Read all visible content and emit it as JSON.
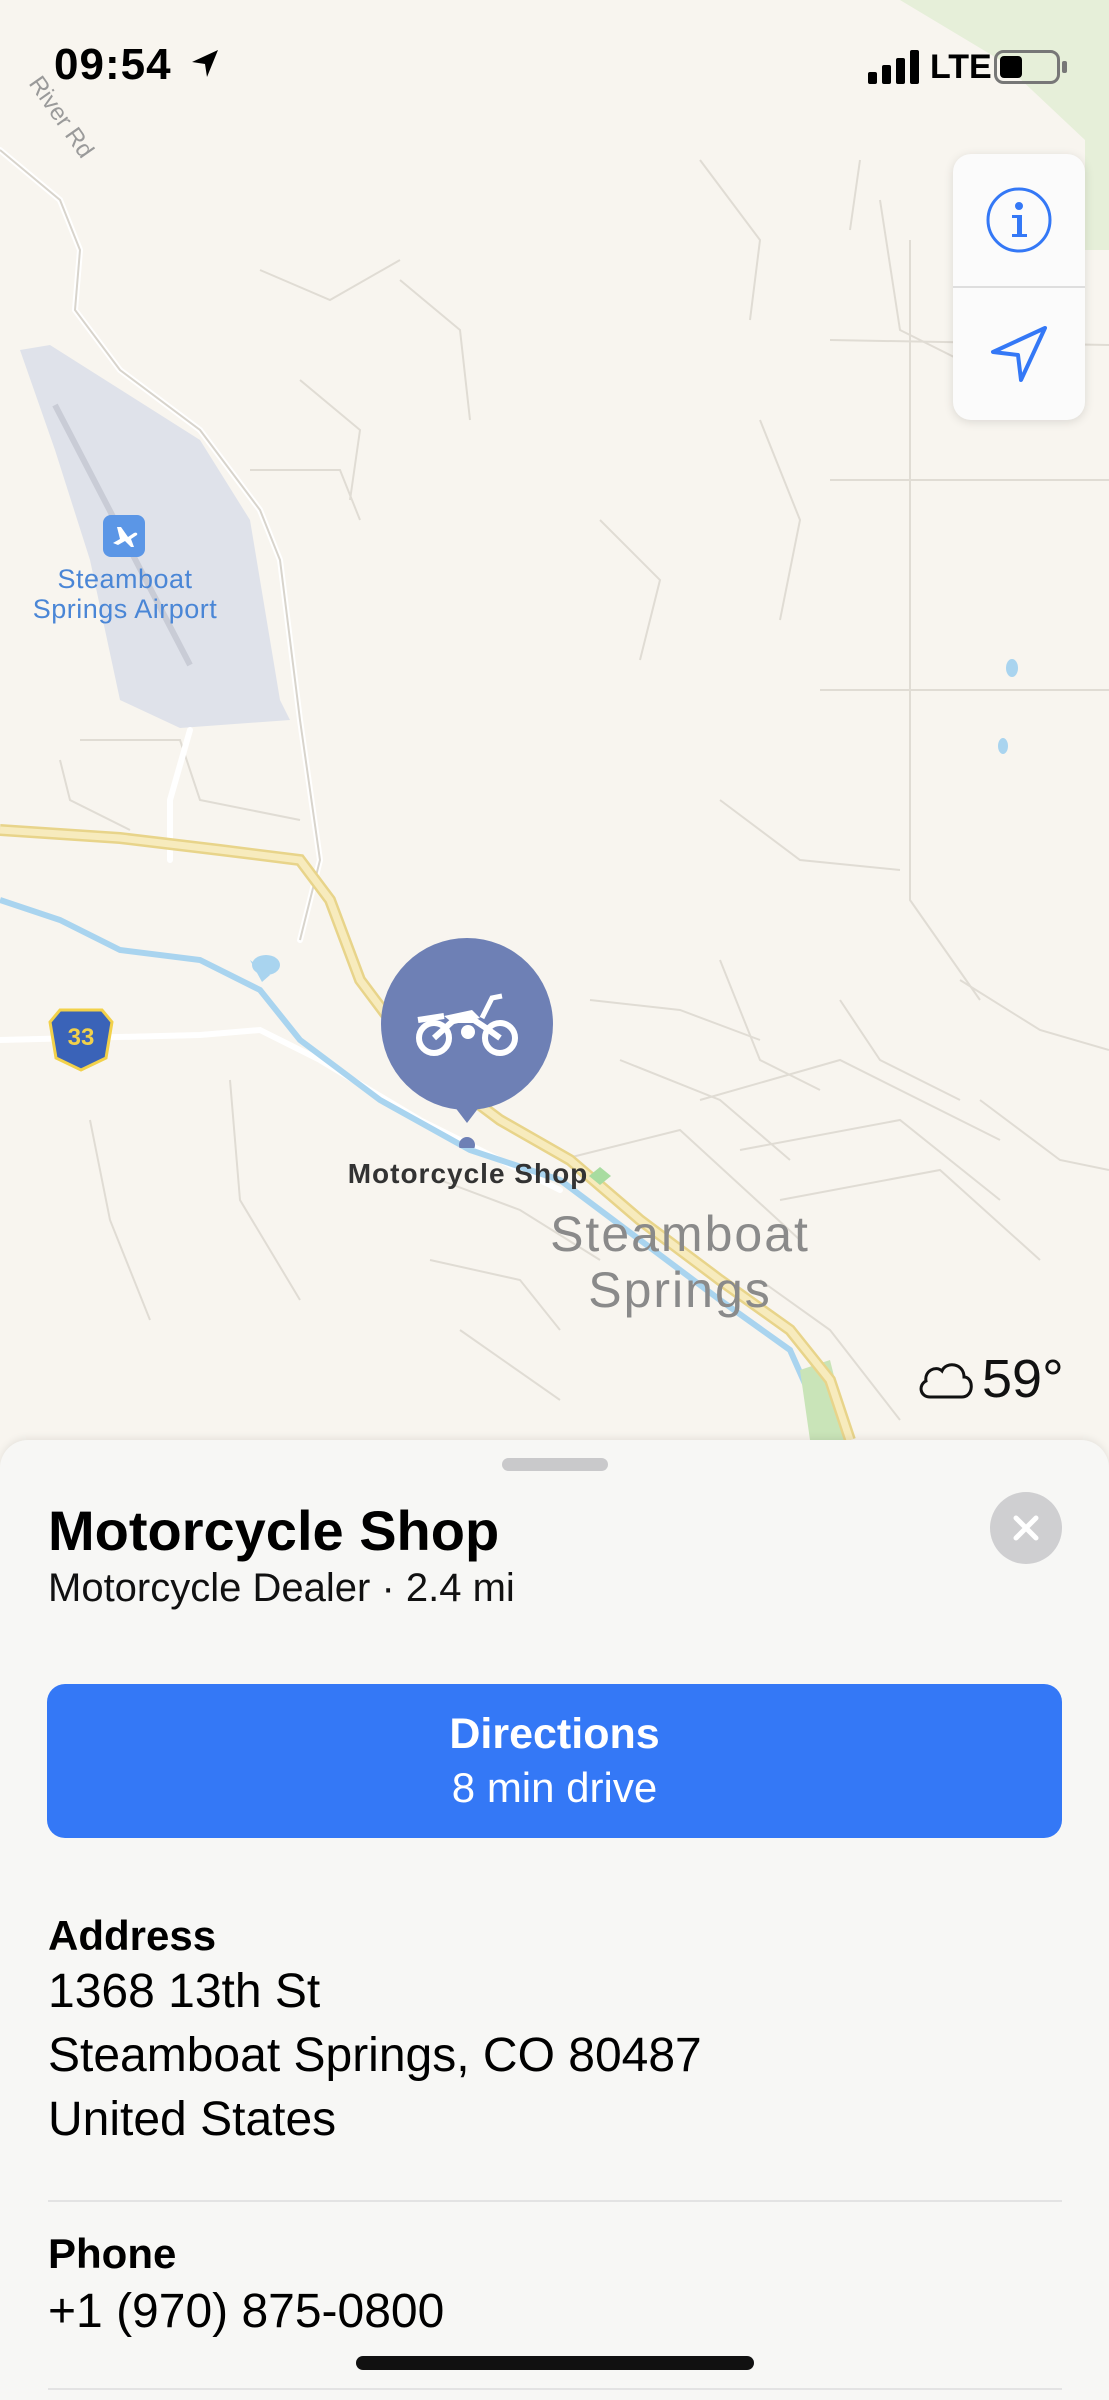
{
  "status_bar": {
    "time": "09:54",
    "network": "LTE"
  },
  "map": {
    "road_label": "River Rd",
    "airport_label_line1": "Steamboat",
    "airport_label_line2": "Springs Airport",
    "city_label_line1": "Steamboat",
    "city_label_line2": "Springs",
    "route_shield": "33",
    "pin_label": "Motorcycle Shop",
    "weather_temp": "59°",
    "colors": {
      "pin": "#6e80b5",
      "water": "#a9d4ef",
      "highway": "#f4e3a4",
      "airport": "#dfe2ea"
    }
  },
  "sheet": {
    "title": "Motorcycle Shop",
    "subtitle": "Motorcycle Dealer · 2.4 mi",
    "directions_label": "Directions",
    "directions_sub": "8 min drive",
    "address_label": "Address",
    "address_line1": "1368 13th St",
    "address_line2": "Steamboat Springs, CO  80487",
    "address_line3": "United States",
    "phone_label": "Phone",
    "phone_value": "+1 (970) 875-0800",
    "accent": "#3478f6"
  }
}
